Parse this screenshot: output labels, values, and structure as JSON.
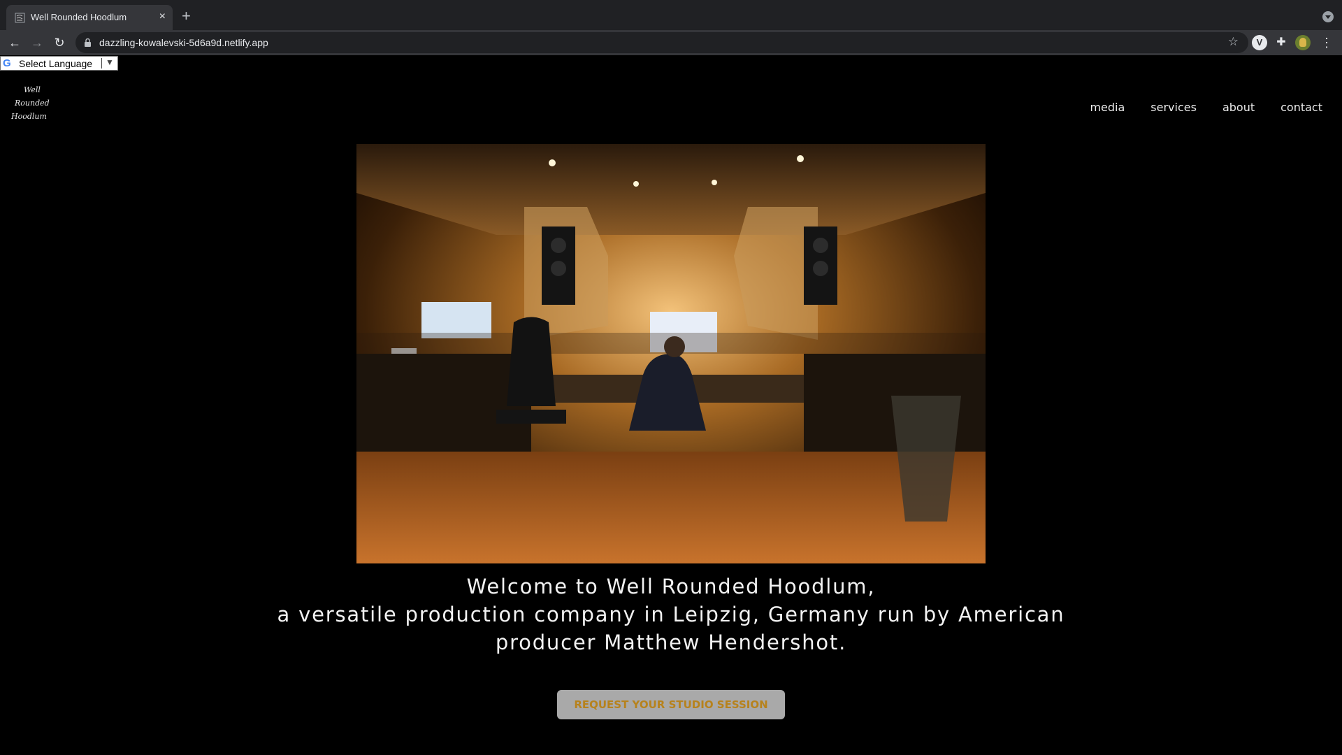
{
  "browser": {
    "tab": {
      "title": "Well Rounded Hoodlum",
      "close": "×"
    },
    "new_tab": "+",
    "nav": {
      "back": "←",
      "forward": "→",
      "reload": "↻"
    },
    "url": "dazzling-kowalevski-5d6a9d.netlify.app",
    "bookmark": "☆",
    "extensions": {
      "v_label": "V",
      "puzzle": "✚",
      "menu": "⋮"
    }
  },
  "translate": {
    "logo": "G",
    "label": "Select Language",
    "arrow": "▼"
  },
  "site": {
    "logo_lines": [
      "Well",
      "Rounded",
      "Hoodlum"
    ],
    "nav": [
      "media",
      "services",
      "about",
      "contact"
    ],
    "welcome": [
      "Welcome to Well Rounded Hoodlum,",
      "a versatile production company in Leipzig, Germany run by American",
      "producer Matthew Hendershot."
    ],
    "cta": "REQUEST YOUR STUDIO SESSION",
    "hero_alt": "recording-studio-photo"
  },
  "colors": {
    "page_bg": "#000000",
    "cta_bg": "#a9a9a9",
    "cta_text": "#b7821c"
  }
}
